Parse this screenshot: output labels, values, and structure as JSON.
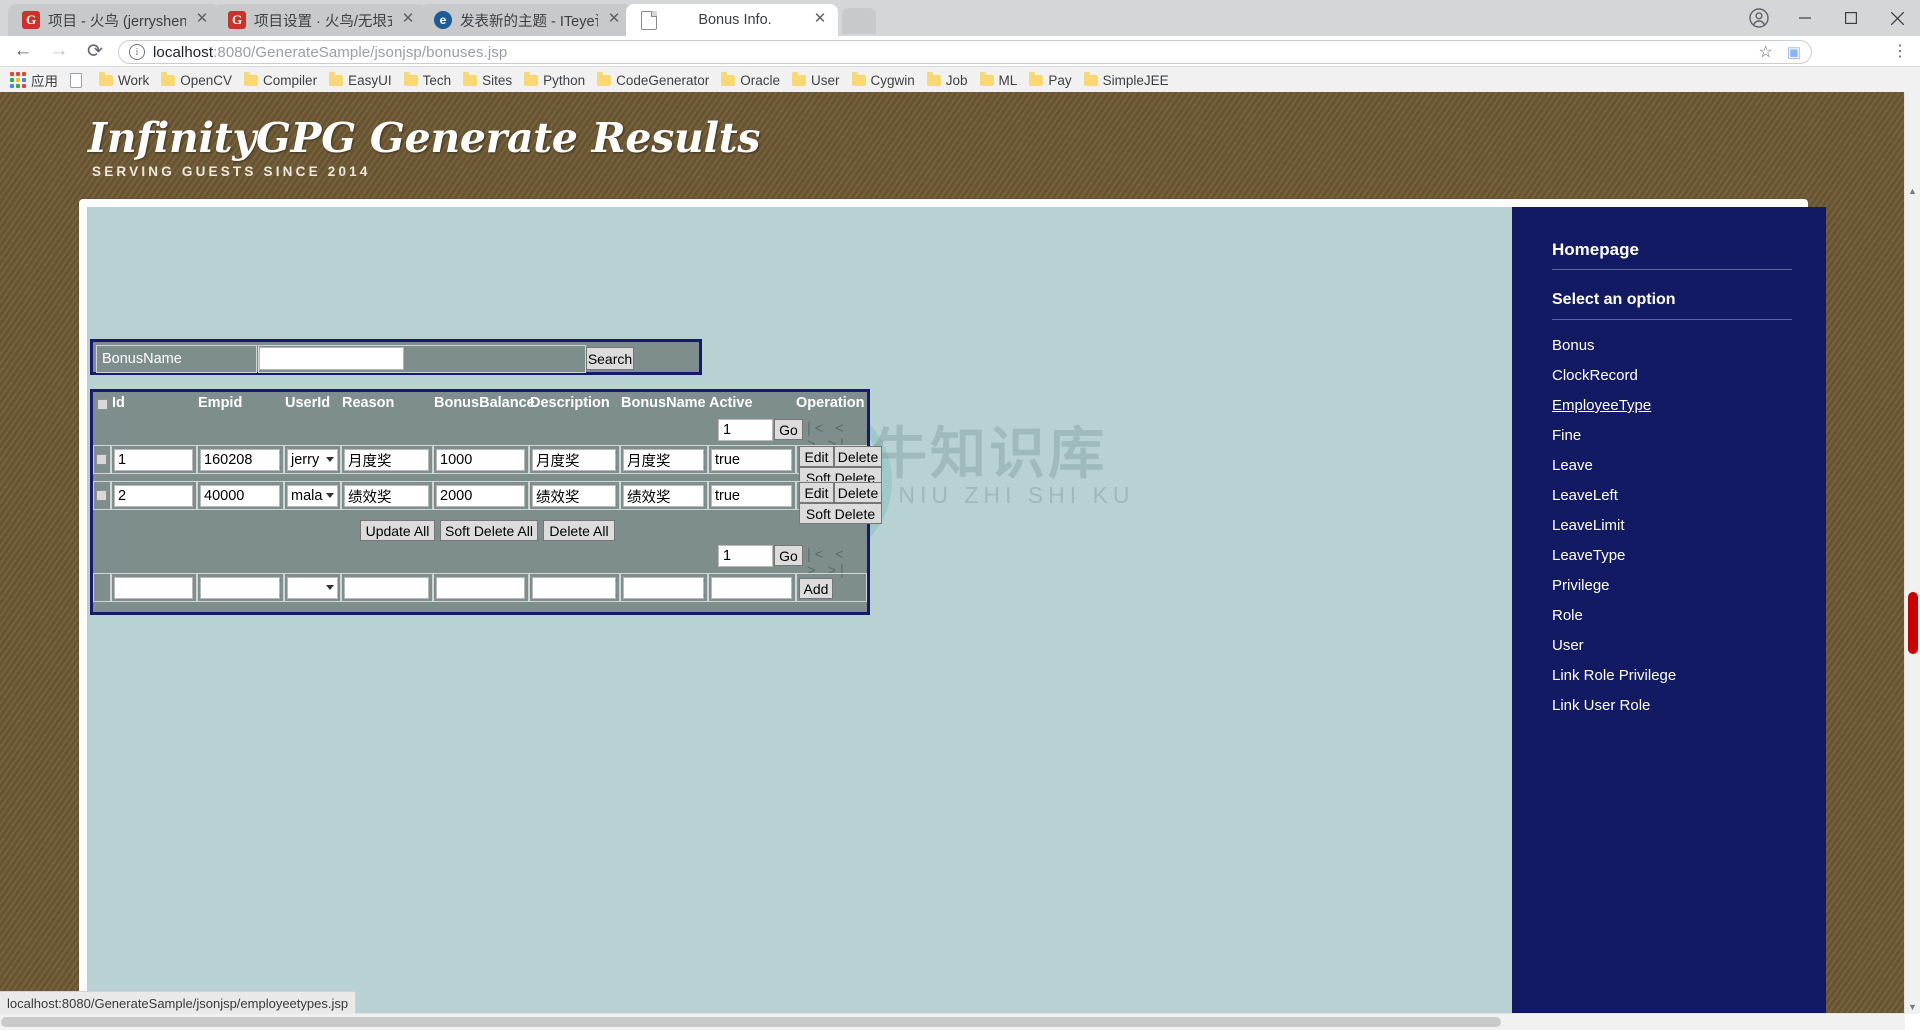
{
  "browser": {
    "tabs": [
      {
        "title": "项目 - 火鸟 (jerryshensj",
        "favicon": "gitee-icon",
        "active": false
      },
      {
        "title": "项目设置 · 火鸟/无垠式代",
        "favicon": "gitee-icon",
        "active": false
      },
      {
        "title": "发表新的主题 - ITeye论坛",
        "favicon": "iteye-icon",
        "active": false
      },
      {
        "title": "Bonus Info.",
        "favicon": "page-icon",
        "active": true
      }
    ],
    "new_tab_label": "",
    "nav": {
      "back": "←",
      "forward": "→",
      "reload": "⟳"
    },
    "omnibox": {
      "url_scheme": "localhost",
      "url_rest": ":8080/GenerateSample/jsonjsp/bonuses.jsp",
      "star": "☆",
      "extension": "▣"
    },
    "menu_icon": "⋮",
    "window": {
      "minimize": "—",
      "maximize": "▢",
      "close": "✕",
      "profile": "person-icon"
    },
    "bookmarks": {
      "apps_label": "应用",
      "items": [
        "Work",
        "OpenCV",
        "Compiler",
        "EasyUI",
        "Tech",
        "Sites",
        "Python",
        "CodeGenerator",
        "Oracle",
        "User",
        "Cygwin",
        "Job",
        "ML",
        "Pay",
        "SimpleJEE"
      ]
    },
    "status_text": "localhost:8080/GenerateSample/jsonjsp/employeetypes.jsp"
  },
  "header": {
    "title": "InfinityGPG Generate Results",
    "subtitle": "SERVING GUESTS SINCE 2014"
  },
  "search": {
    "field_label": "BonusName",
    "field_value": "",
    "button_label": "Search"
  },
  "table": {
    "columns": [
      "Id",
      "Empid",
      "UserId",
      "Reason",
      "BonusBalance",
      "Description",
      "BonusName",
      "Active",
      "Operation"
    ],
    "rows": [
      {
        "id": "1",
        "empid": "160208",
        "userid": "jerry",
        "reason": "月度奖",
        "bonusbalance": "1000",
        "description": "月度奖",
        "bonusname": "月度奖",
        "active": "true",
        "ops": [
          "Edit",
          "Delete",
          "Soft Delete"
        ]
      },
      {
        "id": "2",
        "empid": "40000",
        "userid": "mala",
        "reason": "绩效奖",
        "bonusbalance": "2000",
        "description": "绩效奖",
        "bonusname": "绩效奖",
        "active": "true",
        "ops": [
          "Edit",
          "Delete",
          "Soft Delete"
        ]
      }
    ],
    "new_row": {
      "id": "",
      "empid": "",
      "userid": "",
      "reason": "",
      "bonusbalance": "",
      "description": "",
      "bonusname": "",
      "active": "",
      "add_label": "Add"
    },
    "bulk": {
      "update_all": "Update All",
      "soft_delete_all": "Soft Delete All",
      "delete_all": "Delete All"
    },
    "pager_top": {
      "page": "1",
      "go": "Go",
      "nav": "|< <  > >|"
    },
    "pager_bottom": {
      "page": "1",
      "go": "Go",
      "nav": "|< <  > >|"
    }
  },
  "sidebar": {
    "homepage": "Homepage",
    "section_title": "Select an option",
    "items": [
      {
        "label": "Bonus",
        "hovered": false
      },
      {
        "label": "ClockRecord",
        "hovered": false
      },
      {
        "label": "EmployeeType",
        "hovered": true
      },
      {
        "label": "Fine",
        "hovered": false
      },
      {
        "label": "Leave",
        "hovered": false
      },
      {
        "label": "LeaveLeft",
        "hovered": false
      },
      {
        "label": "LeaveLimit",
        "hovered": false
      },
      {
        "label": "LeaveType",
        "hovered": false
      },
      {
        "label": "Privilege",
        "hovered": false
      },
      {
        "label": "Role",
        "hovered": false
      },
      {
        "label": "User",
        "hovered": false
      },
      {
        "label": "Link Role Privilege",
        "hovered": false
      },
      {
        "label": "Link User Role",
        "hovered": false
      }
    ]
  },
  "watermark": {
    "cn": "小牛知识库",
    "en": "XIAO NIU ZHI SHI KU"
  },
  "colors": {
    "page_bg": "#6e5933",
    "content_bg": "#b8d2d4",
    "sidebar_bg": "#131a64",
    "grid_border": "#171a6b",
    "grid_bg": "#7d8e8c"
  }
}
